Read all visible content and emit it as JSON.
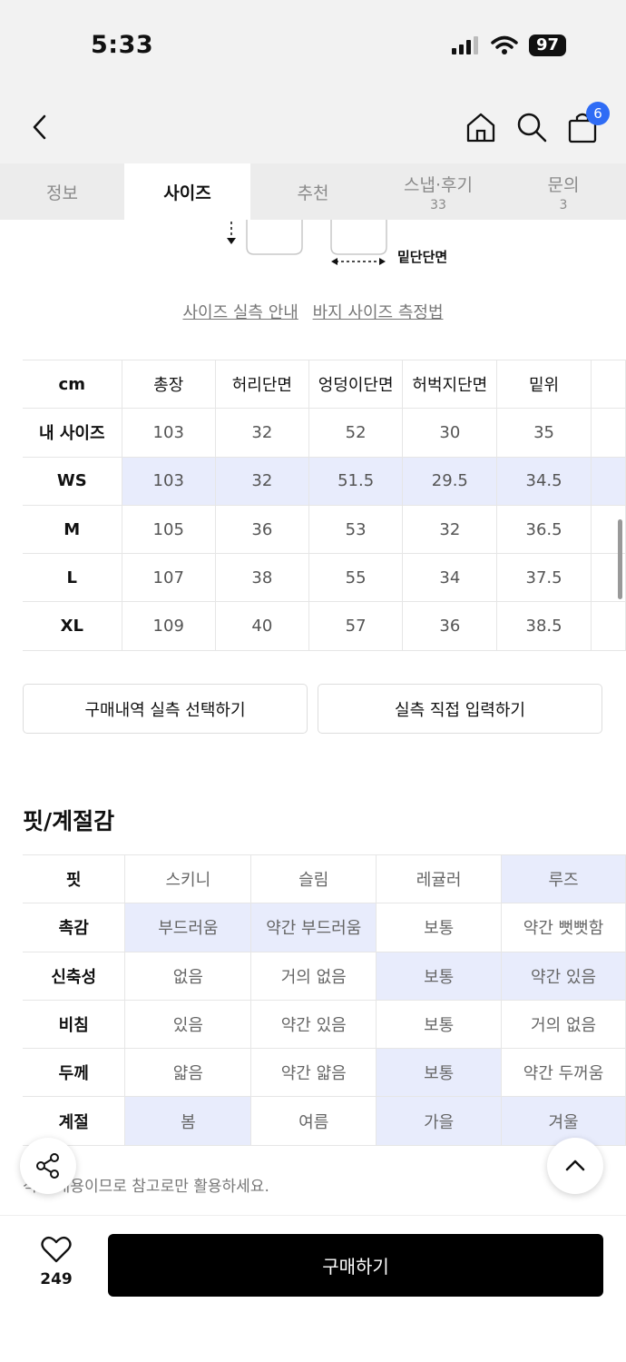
{
  "status": {
    "time": "5:33",
    "battery": "97"
  },
  "header": {
    "cart_count": "6"
  },
  "tabs": [
    {
      "label": "정보",
      "count": ""
    },
    {
      "label": "사이즈",
      "count": ""
    },
    {
      "label": "추천",
      "count": ""
    },
    {
      "label": "스냅·후기",
      "count": "33"
    },
    {
      "label": "문의",
      "count": "3"
    }
  ],
  "diagram": {
    "label": "밑단단면"
  },
  "guide": {
    "link1": "사이즈 실측 안내",
    "link2": "바지 사이즈 측정법"
  },
  "size_table": {
    "headers": [
      "cm",
      "총장",
      "허리단면",
      "엉덩이단면",
      "허벅지단면",
      "밑위"
    ],
    "rows": [
      [
        "내 사이즈",
        "103",
        "32",
        "52",
        "30",
        "35"
      ],
      [
        "WS",
        "103",
        "32",
        "51.5",
        "29.5",
        "34.5"
      ],
      [
        "M",
        "105",
        "36",
        "53",
        "32",
        "36.5"
      ],
      [
        "L",
        "107",
        "38",
        "55",
        "34",
        "37.5"
      ],
      [
        "XL",
        "109",
        "40",
        "57",
        "36",
        "38.5"
      ]
    ]
  },
  "buttons": {
    "select_purchase": "구매내역 실측 선택하기",
    "manual_input": "실측 직접 입력하기"
  },
  "fit": {
    "title": "핏/계절감",
    "rows": [
      {
        "label": "핏",
        "options": [
          "스키니",
          "슬림",
          "레귤러",
          "루즈"
        ],
        "selected": [
          3
        ]
      },
      {
        "label": "촉감",
        "options": [
          "부드러움",
          "약간 부드러움",
          "보통",
          "약간 뻣뻣함"
        ],
        "selected": [
          0,
          1
        ]
      },
      {
        "label": "신축성",
        "options": [
          "없음",
          "거의 없음",
          "보통",
          "약간 있음"
        ],
        "selected": [
          2,
          3
        ]
      },
      {
        "label": "비침",
        "options": [
          "있음",
          "약간 있음",
          "보통",
          "거의 없음"
        ],
        "selected": []
      },
      {
        "label": "두께",
        "options": [
          "얇음",
          "약간 얇음",
          "보통",
          "약간 두꺼움"
        ],
        "selected": [
          2
        ]
      },
      {
        "label": "계절",
        "options": [
          "봄",
          "여름",
          "가을",
          "겨울"
        ],
        "selected": [
          0,
          2,
          3
        ]
      }
    ]
  },
  "note": "적인 내용이므로 참고로만 활용하세요.",
  "bottom": {
    "like_count": "249",
    "buy_label": "구매하기"
  },
  "colors": {
    "highlight": "#e8ecfc",
    "badge": "#2f6cf5",
    "buy_button": "#000000"
  }
}
